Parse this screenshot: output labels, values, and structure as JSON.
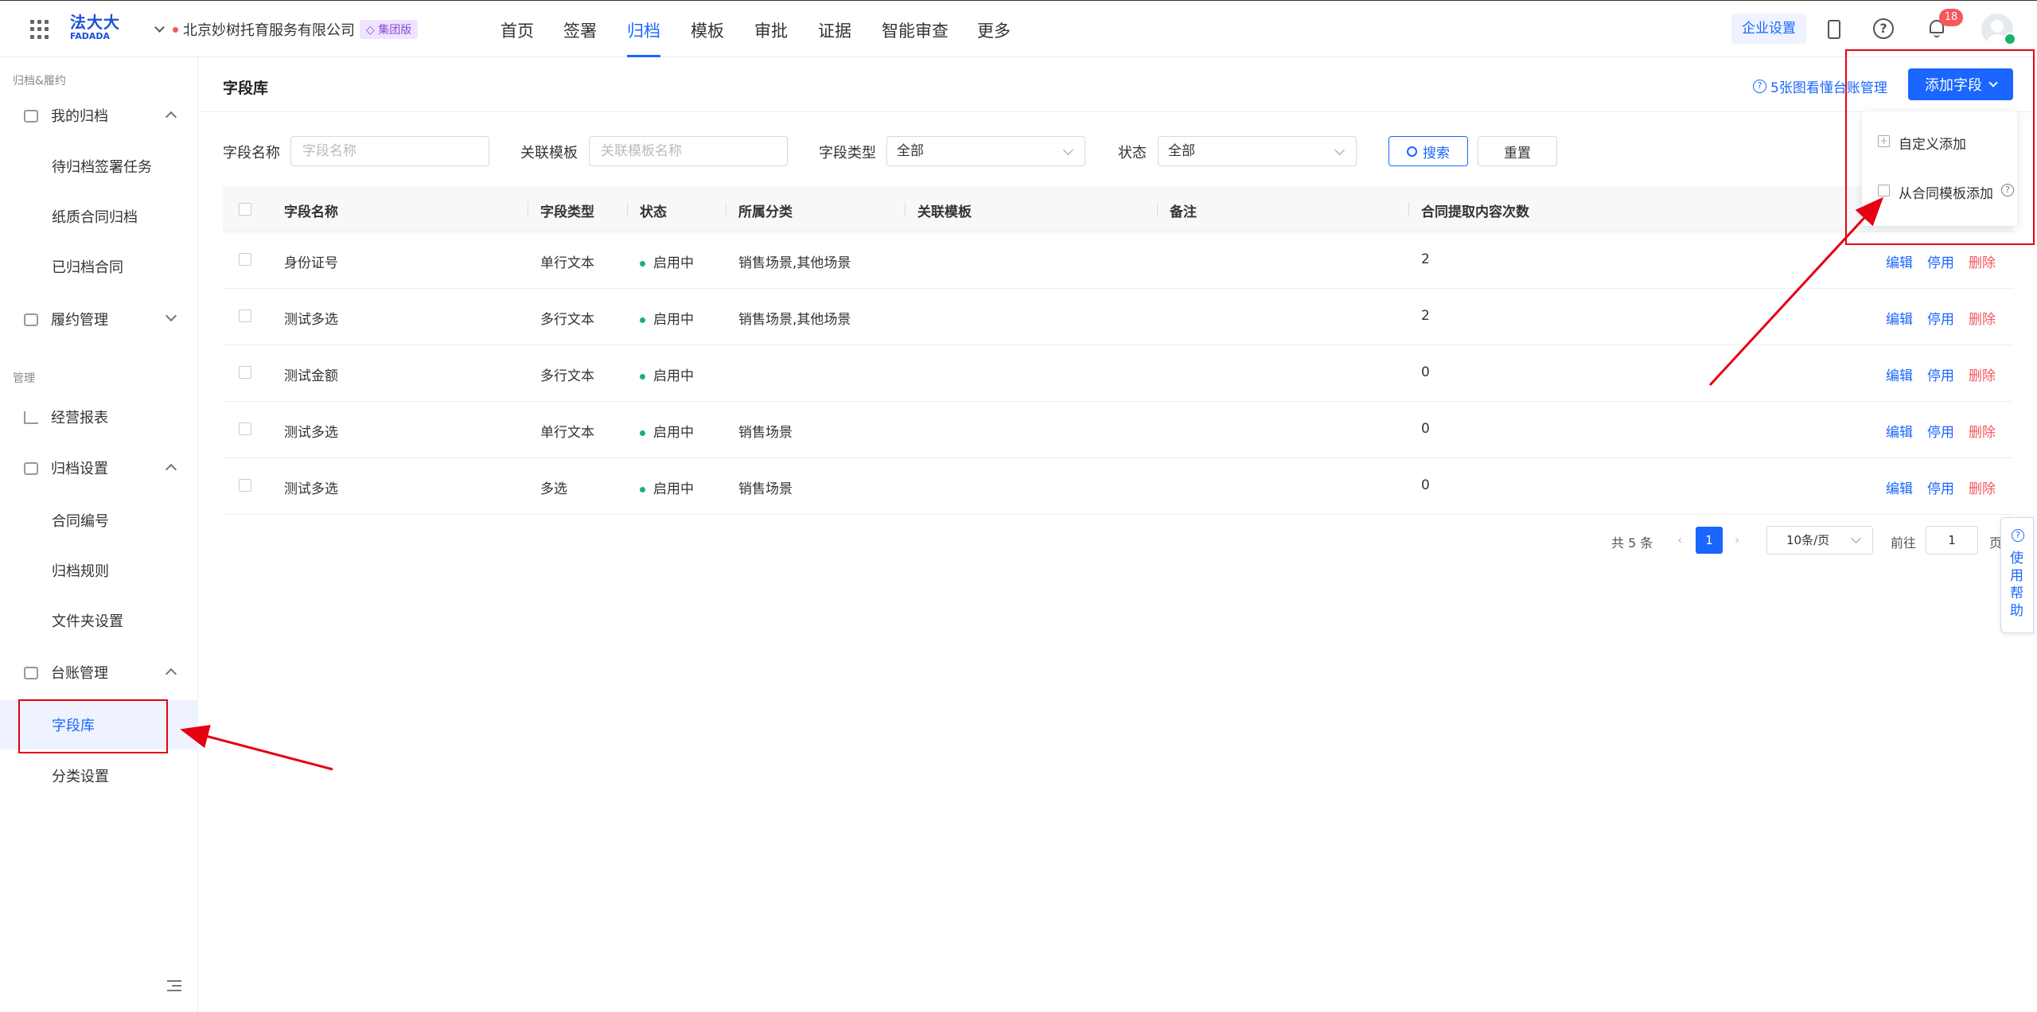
{
  "header": {
    "logo_text": "法大大",
    "logo_sub": "FADADA",
    "company": "北京妙树托育服务有限公司",
    "edition_badge": "集团版",
    "nav": [
      "首页",
      "签署",
      "归档",
      "模板",
      "审批",
      "证据",
      "智能审查",
      "更多"
    ],
    "active_nav": "归档",
    "enterprise_settings": "企业设置",
    "notification_count": "18"
  },
  "sidebar": {
    "group1": "归档&履约",
    "my_archive": "我的归档",
    "pending_tasks": "待归档签署任务",
    "paper_archive": "纸质合同归档",
    "archived_contracts": "已归档合同",
    "performance": "履约管理",
    "group2": "管理",
    "reports": "经营报表",
    "archive_settings": "归档设置",
    "contract_number": "合同编号",
    "archive_rules": "归档规则",
    "folder_settings": "文件夹设置",
    "ledger_mgmt": "台账管理",
    "field_library": "字段库",
    "category_settings": "分类设置"
  },
  "page": {
    "title": "字段库",
    "help_link": "5张图看懂台账管理",
    "add_field_button": "添加字段",
    "dropdown": {
      "custom_add": "自定义添加",
      "from_template": "从合同模板添加"
    }
  },
  "filters": {
    "field_name_label": "字段名称",
    "field_name_placeholder": "字段名称",
    "template_label": "关联模板",
    "template_placeholder": "关联模板名称",
    "type_label": "字段类型",
    "type_value": "全部",
    "status_label": "状态",
    "status_value": "全部",
    "search_button": "搜索",
    "reset_button": "重置"
  },
  "table": {
    "columns": [
      "字段名称",
      "字段类型",
      "状态",
      "所属分类",
      "关联模板",
      "备注",
      "合同提取内容次数"
    ],
    "rows": [
      {
        "name": "身份证号",
        "type": "单行文本",
        "status": "启用中",
        "category": "销售场景,其他场景",
        "template": "",
        "note": "",
        "count": "2"
      },
      {
        "name": "测试多选",
        "type": "多行文本",
        "status": "启用中",
        "category": "销售场景,其他场景",
        "template": "",
        "note": "",
        "count": "2"
      },
      {
        "name": "测试金额",
        "type": "多行文本",
        "status": "启用中",
        "category": "",
        "template": "",
        "note": "",
        "count": "0"
      },
      {
        "name": "测试多选",
        "type": "单行文本",
        "status": "启用中",
        "category": "销售场景",
        "template": "",
        "note": "",
        "count": "0"
      },
      {
        "name": "测试多选",
        "type": "多选",
        "status": "启用中",
        "category": "销售场景",
        "template": "",
        "note": "",
        "count": "0"
      }
    ],
    "actions": {
      "edit": "编辑",
      "disable": "停用",
      "delete": "删除"
    }
  },
  "pagination": {
    "total": "共 5 条",
    "current_page": "1",
    "page_size": "10条/页",
    "goto_label": "前往",
    "goto_value": "1",
    "page_suffix": "页"
  },
  "help_float": "使用帮助",
  "colors": {
    "accent": "#1a66ff",
    "danger": "#f5575c",
    "success": "#1ab26b",
    "annotation": "#e60012"
  }
}
